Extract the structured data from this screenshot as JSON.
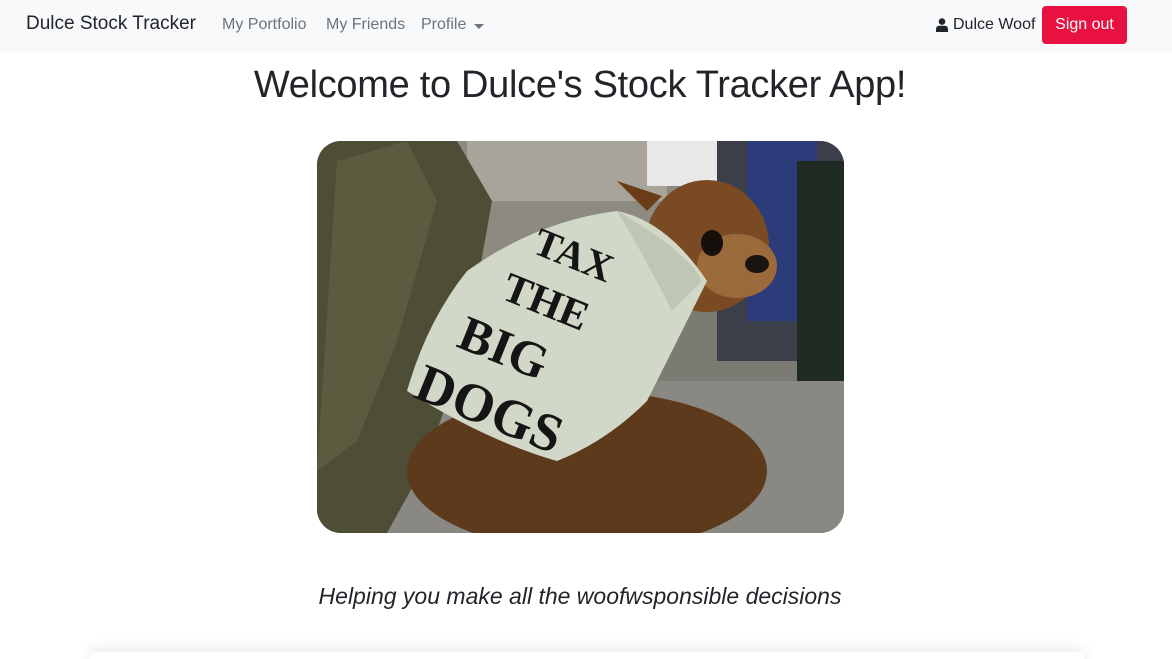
{
  "navbar": {
    "brand": "Dulce Stock Tracker",
    "links": [
      "My Portfolio",
      "My Friends"
    ],
    "profile_label": "Profile",
    "user_name": "Dulce Woof",
    "signout_label": "Sign out",
    "signout_color": "#e8113f"
  },
  "main": {
    "title": "Welcome to Dulce's Stock Tracker App!",
    "tagline": "Helping you make all the woofwsponsible decisions",
    "photo_sign_lines": [
      "TAX",
      "THE",
      "BIG",
      "DOGS"
    ]
  }
}
